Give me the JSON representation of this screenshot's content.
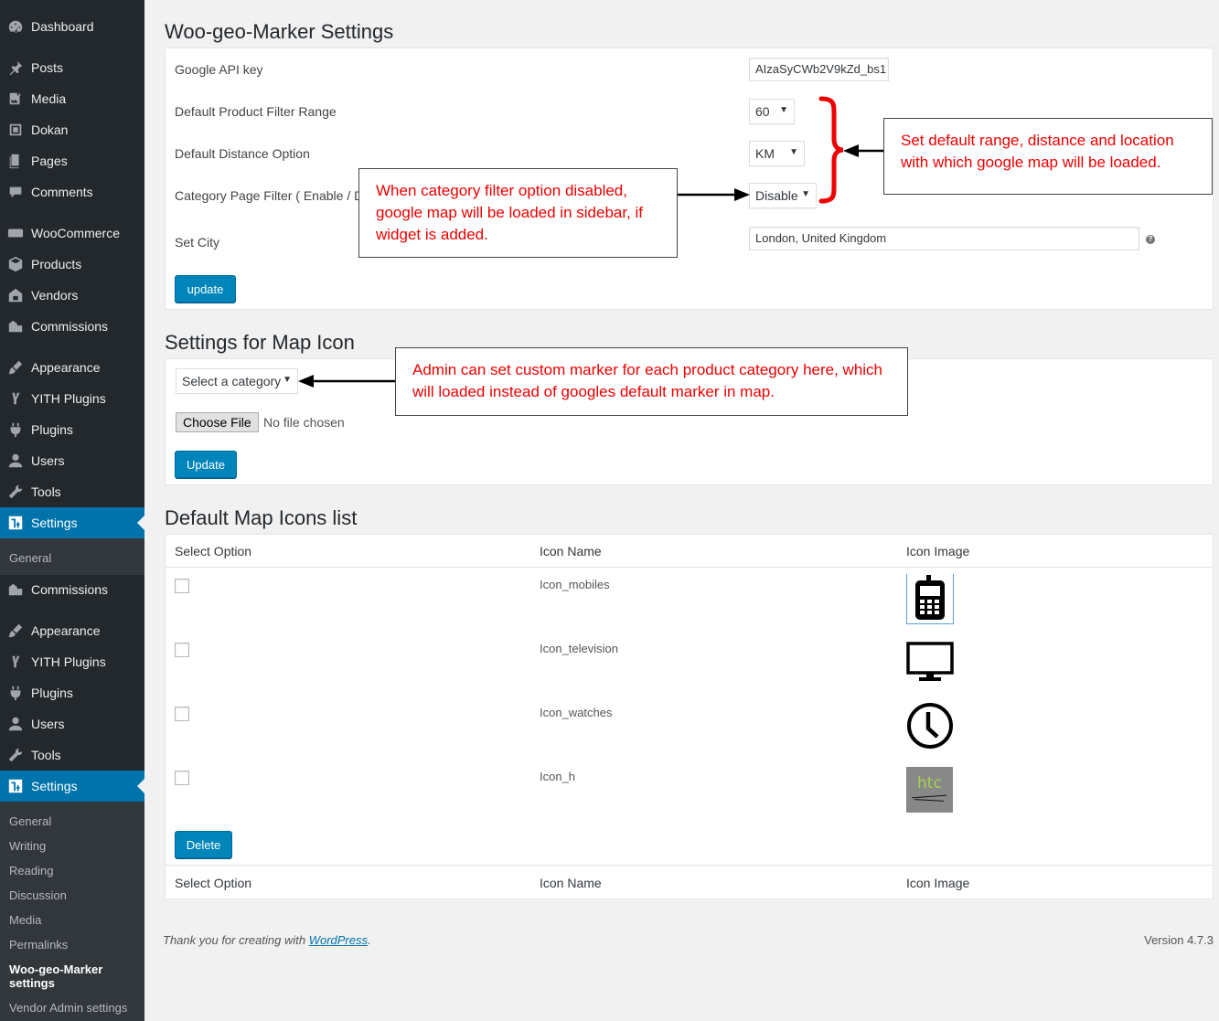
{
  "sidebar": {
    "top_menu": [
      {
        "label": "Dashboard",
        "icon": "dashboard-icon"
      },
      {
        "label": "Posts",
        "icon": "pin-icon"
      },
      {
        "label": "Media",
        "icon": "media-icon"
      },
      {
        "label": "Dokan",
        "icon": "dokan-icon"
      },
      {
        "label": "Pages",
        "icon": "pages-icon"
      },
      {
        "label": "Comments",
        "icon": "comment-icon"
      },
      {
        "label": "WooCommerce",
        "icon": "woo-icon"
      },
      {
        "label": "Products",
        "icon": "box-icon"
      },
      {
        "label": "Vendors",
        "icon": "vendors-icon"
      },
      {
        "label": "Commissions",
        "icon": "commissions-icon"
      },
      {
        "label": "Appearance",
        "icon": "brush-icon"
      },
      {
        "label": "YITH Plugins",
        "icon": "yith-icon"
      },
      {
        "label": "Plugins",
        "icon": "plugin-icon"
      },
      {
        "label": "Users",
        "icon": "user-icon"
      },
      {
        "label": "Tools",
        "icon": "wrench-icon"
      },
      {
        "label": "Settings",
        "icon": "settings-icon"
      }
    ],
    "sub_general_1": "General",
    "mid_menu": [
      {
        "label": "Commissions",
        "icon": "commissions-icon"
      },
      {
        "label": "Appearance",
        "icon": "brush-icon"
      },
      {
        "label": "YITH Plugins",
        "icon": "yith-icon"
      },
      {
        "label": "Plugins",
        "icon": "plugin-icon"
      },
      {
        "label": "Users",
        "icon": "user-icon"
      },
      {
        "label": "Tools",
        "icon": "wrench-icon"
      },
      {
        "label": "Settings",
        "icon": "settings-icon"
      }
    ],
    "submenu": [
      "General",
      "Writing",
      "Reading",
      "Discussion",
      "Media",
      "Permalinks"
    ],
    "submenu_current": "Woo-geo-Marker settings",
    "submenu_last": "Vendor Admin settings"
  },
  "settings": {
    "title": "Woo-geo-Marker Settings",
    "api_key_label": "Google API key",
    "api_key_value": "AIzaSyCWb2V9kZd_bs1",
    "range_label": "Default Product Filter Range",
    "range_value": "60",
    "distance_label": "Default Distance Option",
    "distance_value": "KM",
    "category_filter_label": "Category Page Filter ( Enable / D",
    "category_filter_value": "Disable",
    "city_label": "Set City",
    "city_value": "London, United Kingdom",
    "update_label": "update"
  },
  "map_icon": {
    "title": "Settings for Map Icon",
    "category_select": "Select a category",
    "choose_file": "Choose File",
    "no_file": "No file chosen",
    "update_label": "Update"
  },
  "icons_list": {
    "title": "Default Map Icons list",
    "col_select": "Select Option",
    "col_name": "Icon Name",
    "col_image": "Icon Image",
    "rows": [
      {
        "name": "Icon_mobiles",
        "icon": "mobile-phone-icon"
      },
      {
        "name": "Icon_television",
        "icon": "television-icon"
      },
      {
        "name": "Icon_watches",
        "icon": "clock-icon"
      },
      {
        "name": "Icon_h",
        "icon": "htc-logo-icon",
        "logo_text": "htc"
      }
    ],
    "delete_label": "Delete"
  },
  "callouts": {
    "category": "When category filter option disabled, google map will be loaded in sidebar, if widget is added.",
    "defaults": "Set default range, distance and location with which google map will be loaded.",
    "marker": "Admin can set custom marker for each product category here, which will loaded instead of googles default marker in map."
  },
  "footer": {
    "thanks_prefix": "Thank you for creating with ",
    "thanks_link": "WordPress",
    "thanks_suffix": ".",
    "version": "Version 4.7.3"
  },
  "colors": {
    "accent": "#0073aa",
    "callout_text": "#e00000",
    "bracket": "#e00000"
  }
}
